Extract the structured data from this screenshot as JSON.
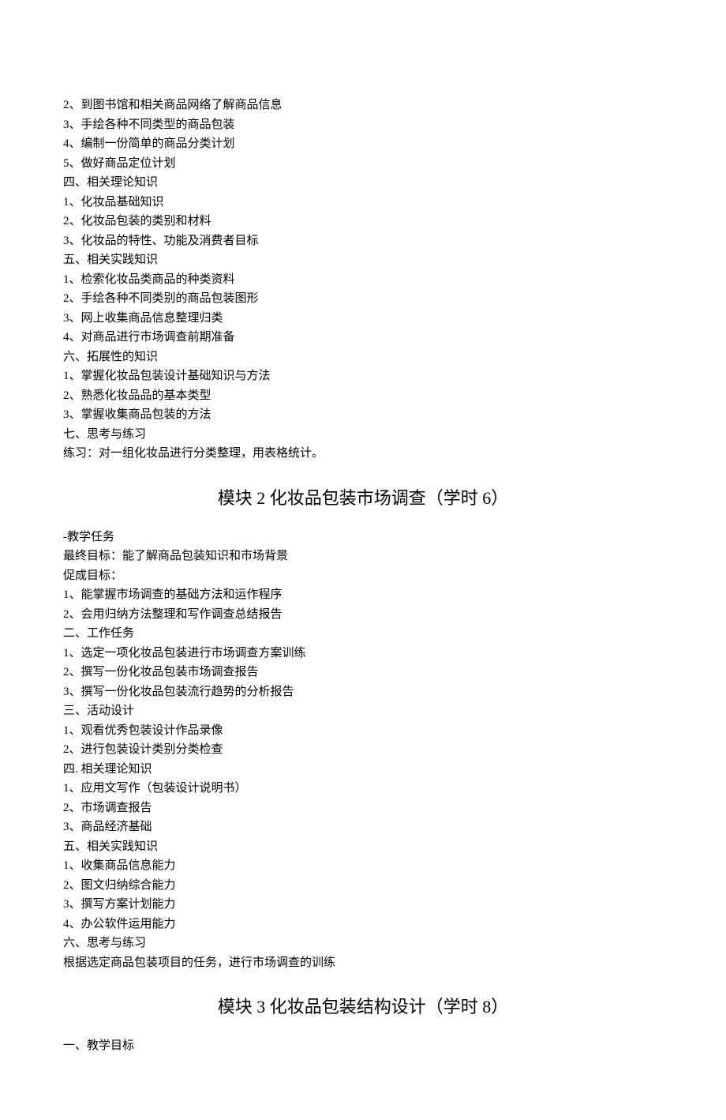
{
  "topItems": [
    "2、到图书馆和相关商品网络了解商品信息",
    "3、手绘各种不同类型的商品包装",
    "4、编制一份简单的商品分类计划",
    "5、做好商品定位计划"
  ],
  "sec4": {
    "heading": "四、相关理论知识",
    "items": [
      "1、化妆品基础知识",
      "2、化妆品包装的类别和材料",
      "3、化妆品的特性、功能及消费者目标"
    ]
  },
  "sec5": {
    "heading": "五、相关实践知识",
    "items": [
      "1、检索化妆品类商品的种类资料",
      "2、手绘各种不同类别的商品包装图形",
      "3、网上收集商品信息整理归类",
      "4、对商品进行市场调查前期准备"
    ]
  },
  "sec6": {
    "heading": "六、拓展性的知识",
    "items": [
      "1、掌握化妆品包装设计基础知识与方法",
      "2、熟悉化妆品品的基本类型",
      "3、掌握收集商品包装的方法"
    ]
  },
  "sec7": {
    "heading": "七、思考与练习",
    "body": "练习：对一组化妆品进行分类整理，用表格统计。"
  },
  "module2": {
    "title": "模块 2 化妆品包装市场调查（学时 6）",
    "task": {
      "heading": "-教学任务",
      "finalGoal": "最终目标：能了解商品包装知识和市场背景",
      "achieveLabel": "促成目标：",
      "achieveItems": [
        "1、能掌握市场调查的基础方法和运作程序",
        "2、会用归纳方法整理和写作调查总结报告"
      ]
    },
    "s2": {
      "heading": "二、工作任务",
      "items": [
        "1、选定一项化妆品包装进行市场调查方案训练",
        "2、撰写一份化妆品包装市场调查报告",
        "3、撰写一份化妆品包装流行趋势的分析报告"
      ]
    },
    "s3": {
      "heading": "三、活动设计",
      "items": [
        "1、观看优秀包装设计作品录像",
        "2、进行包装设计类别分类检查"
      ]
    },
    "s4": {
      "heading": "四. 相关理论知识",
      "items": [
        "1、应用文写作（包装设计说明书）",
        "2、市场调查报告",
        "3、商品经济基础"
      ]
    },
    "s5": {
      "heading": "五、相关实践知识",
      "items": [
        "1、收集商品信息能力",
        "2、图文归纳综合能力",
        "3、撰写方案计划能力",
        "4、办公软件运用能力"
      ]
    },
    "s6": {
      "heading": "六、思考与练习",
      "body": "根据选定商品包装项目的任务，进行市场调查的训练"
    }
  },
  "module3": {
    "title": "模块 3 化妆品包装结构设计（学时 8）",
    "s1": {
      "heading": "一、教学目标"
    }
  }
}
